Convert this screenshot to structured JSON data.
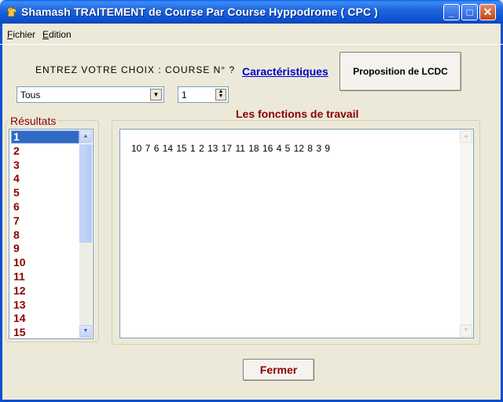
{
  "window": {
    "title": "Shamash TRAITEMENT de Course Par Course  Hyppodrome ( CPC )",
    "min_glyph": "_",
    "max_glyph": "□",
    "close_glyph": "✕"
  },
  "menu": [
    {
      "accel": "F",
      "rest": "ichier"
    },
    {
      "accel": "E",
      "rest": "dition"
    }
  ],
  "prompt": "ENTREZ VOTRE CHOIX  :  COURSE N° ?",
  "link_label": "Caractéristiques",
  "lcdc_button": "Proposition de LCDC",
  "combo": {
    "value": "Tous",
    "arrow": "▼"
  },
  "spinner": {
    "value": "1",
    "up": "▲",
    "down": "▼"
  },
  "results": {
    "label": "Résultats",
    "items": [
      "1",
      "2",
      "3",
      "4",
      "5",
      "6",
      "7",
      "8",
      "9",
      "10",
      "11",
      "12",
      "13",
      "14",
      "15"
    ],
    "selected": "1"
  },
  "functions": {
    "label": "Les fonctions de travail",
    "text": "10  7  6  14  15  1  2  13  17  11  18  16  4  5  12  8  3  9"
  },
  "close_button": "Fermer",
  "colors": {
    "accent": "#8B0000",
    "link": "#0000CC",
    "titlebar": "#0A4FCF"
  }
}
